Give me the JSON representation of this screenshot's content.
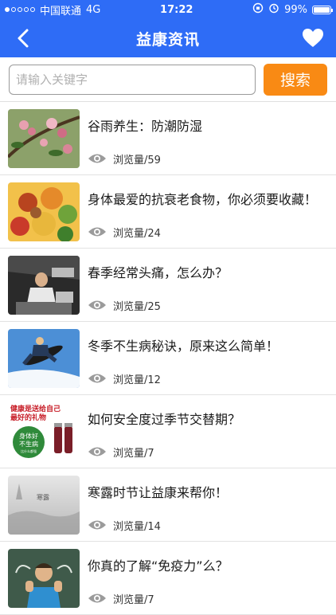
{
  "status_bar": {
    "carrier": "中国联通",
    "network": "4G",
    "time": "17:22",
    "battery": "99%",
    "battery_level": 0.99
  },
  "nav": {
    "title": "益康资讯",
    "back_icon": "back-chevron-icon",
    "favorite_icon": "heart-icon"
  },
  "search": {
    "placeholder": "请输入关键字",
    "value": "",
    "button_label": "搜索"
  },
  "colors": {
    "header_blue": "#2e6cf6",
    "search_orange": "#f98a14"
  },
  "articles": [
    {
      "title": "谷雨养生：防潮防湿",
      "views": "浏览量/59",
      "thumb": "flower-branch"
    },
    {
      "title": "身体最爱的抗衰老食物，你必须要收藏！",
      "views": "浏览量/24",
      "thumb": "vegetables"
    },
    {
      "title": "春季经常头痛，怎么办？",
      "views": "浏览量/25",
      "thumb": "stressed-man"
    },
    {
      "title": "冬季不生病秘诀，原来这么简单！",
      "views": "浏览量/12",
      "thumb": "snowboarder"
    },
    {
      "title": "如何安全度过季节交替期？",
      "views": "浏览量/7",
      "thumb": "health-product-ad"
    },
    {
      "title": "寒露时节让益康来帮你！",
      "views": "浏览量/14",
      "thumb": "foggy-landscape"
    },
    {
      "title": "你真的了解“免疫力”么？",
      "views": "浏览量/7",
      "thumb": "strong-boy"
    }
  ],
  "thumb_texts": {
    "ad_line1": "健康是送给自己",
    "ad_line2": "最好的礼物",
    "ad_badge1": "身体好",
    "ad_badge2": "不生病",
    "ad_badge3": "比什么都强",
    "fog_label": "寒露"
  }
}
